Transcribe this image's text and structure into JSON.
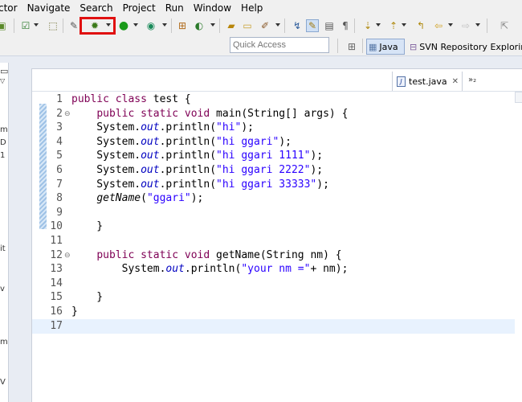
{
  "menu": [
    "ctor",
    "Navigate",
    "Search",
    "Project",
    "Run",
    "Window",
    "Help"
  ],
  "toolbar": {
    "quick_access_placeholder": "Quick Access",
    "perspectives": [
      "Java",
      "SVN Repository Exploring"
    ]
  },
  "left_fragments": [
    "m",
    "D",
    "1",
    "it",
    "v",
    "m",
    "V"
  ],
  "editor": {
    "tab_label": "test.java",
    "overflow": "»₂",
    "lines": [
      {
        "n": "1",
        "tokens": [
          [
            "kw",
            "public"
          ],
          [
            "p",
            " "
          ],
          [
            "kw",
            "class"
          ],
          [
            "p",
            " test {"
          ]
        ]
      },
      {
        "n": "2",
        "fold": "⊖",
        "tokens": [
          [
            "p",
            "    "
          ],
          [
            "kw",
            "public"
          ],
          [
            "p",
            " "
          ],
          [
            "kw",
            "static"
          ],
          [
            "p",
            " "
          ],
          [
            "kw",
            "void"
          ],
          [
            "p",
            " main(String[] args) {"
          ]
        ]
      },
      {
        "n": "3",
        "tokens": [
          [
            "p",
            "    System."
          ],
          [
            "fld",
            "out"
          ],
          [
            "p",
            ".println("
          ],
          [
            "str",
            "\"hi\""
          ],
          [
            "p",
            ");"
          ]
        ]
      },
      {
        "n": "4",
        "tokens": [
          [
            "p",
            "    System."
          ],
          [
            "fld",
            "out"
          ],
          [
            "p",
            ".println("
          ],
          [
            "str",
            "\"hi ggari\""
          ],
          [
            "p",
            ");"
          ]
        ]
      },
      {
        "n": "5",
        "tokens": [
          [
            "p",
            "    System."
          ],
          [
            "fld",
            "out"
          ],
          [
            "p",
            ".println("
          ],
          [
            "str",
            "\"hi ggari 1111\""
          ],
          [
            "p",
            ");"
          ]
        ]
      },
      {
        "n": "6",
        "tokens": [
          [
            "p",
            "    System."
          ],
          [
            "fld",
            "out"
          ],
          [
            "p",
            ".println("
          ],
          [
            "str",
            "\"hi ggari 2222\""
          ],
          [
            "p",
            ");"
          ]
        ]
      },
      {
        "n": "7",
        "tokens": [
          [
            "p",
            "    System."
          ],
          [
            "fld",
            "out"
          ],
          [
            "p",
            ".println("
          ],
          [
            "str",
            "\"hi ggari 33333\""
          ],
          [
            "p",
            ");"
          ]
        ]
      },
      {
        "n": "8",
        "tokens": [
          [
            "p",
            "    "
          ],
          [
            "ital",
            "getName"
          ],
          [
            "p",
            "("
          ],
          [
            "str",
            "\"ggari\""
          ],
          [
            "p",
            ");"
          ]
        ]
      },
      {
        "n": "9",
        "tokens": [
          [
            "p",
            ""
          ]
        ]
      },
      {
        "n": "10",
        "tokens": [
          [
            "p",
            "    }"
          ]
        ]
      },
      {
        "n": "11",
        "tokens": [
          [
            "p",
            ""
          ]
        ]
      },
      {
        "n": "12",
        "fold": "⊖",
        "tokens": [
          [
            "p",
            "    "
          ],
          [
            "kw",
            "public"
          ],
          [
            "p",
            " "
          ],
          [
            "kw",
            "static"
          ],
          [
            "p",
            " "
          ],
          [
            "kw",
            "void"
          ],
          [
            "p",
            " getName(String nm) {"
          ]
        ]
      },
      {
        "n": "13",
        "tokens": [
          [
            "p",
            "        System."
          ],
          [
            "fld",
            "out"
          ],
          [
            "p",
            ".println("
          ],
          [
            "str",
            "\"your nm =\""
          ],
          [
            "p",
            "+ nm);"
          ]
        ]
      },
      {
        "n": "14",
        "tokens": [
          [
            "p",
            ""
          ]
        ]
      },
      {
        "n": "15",
        "tokens": [
          [
            "p",
            "    }"
          ]
        ]
      },
      {
        "n": "16",
        "tokens": [
          [
            "p",
            "}"
          ]
        ]
      },
      {
        "n": "17",
        "current": true,
        "tokens": [
          [
            "p",
            ""
          ]
        ]
      }
    ]
  }
}
